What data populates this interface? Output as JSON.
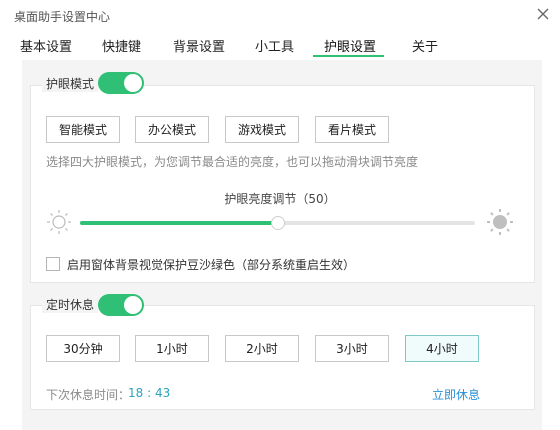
{
  "window": {
    "title": "桌面助手设置中心",
    "close_icon": "close-icon"
  },
  "tabs": [
    {
      "label": "基本设置"
    },
    {
      "label": "快捷键"
    },
    {
      "label": "背景设置"
    },
    {
      "label": "小工具"
    },
    {
      "label": "护眼设置",
      "active": true
    },
    {
      "label": "关于"
    }
  ],
  "eye_protection": {
    "label": "护眼模式",
    "enabled": true,
    "modes": [
      "智能模式",
      "办公模式",
      "游戏模式",
      "看片模式"
    ],
    "description": "选择四大护眼模式，为您调节最合适的亮度，也可以拖动滑块调节亮度",
    "brightness_label": "护眼亮度调节（50）",
    "brightness_value": 50,
    "brightness_range": [
      0,
      100
    ],
    "icons": {
      "low": "dim-sun-icon",
      "high": "bright-sun-icon"
    },
    "checkbox_checked": false,
    "checkbox_label": "启用窗体背景视觉保护豆沙绿色（部分系统重启生效）"
  },
  "rest_timer": {
    "label": "定时休息",
    "enabled": true,
    "options": [
      "30分钟",
      "1小时",
      "2小时",
      "3小时",
      "4小时"
    ],
    "selected": "4小时",
    "next_rest_label": "下次休息时间：",
    "next_rest_time": "18 : 43",
    "rest_now": "立即休息"
  },
  "colors": {
    "accent": "#2fbf75",
    "link": "#2a8fd6",
    "time": "#2aa5b8"
  }
}
